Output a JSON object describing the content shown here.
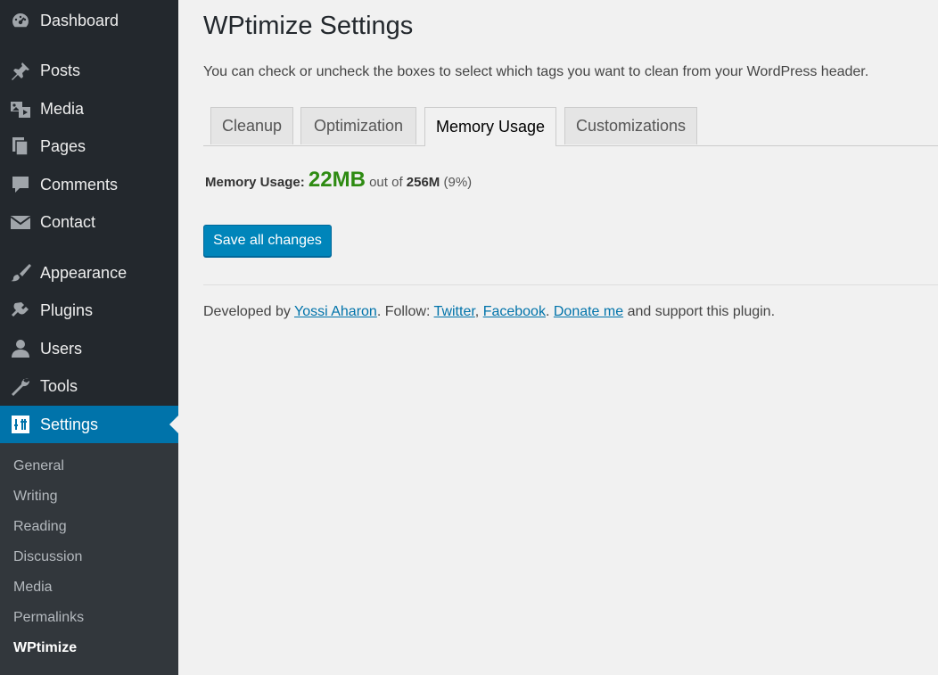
{
  "sidebar": {
    "items": [
      {
        "label": "Dashboard",
        "icon": "dashboard-icon"
      },
      {
        "label": "Posts",
        "icon": "pushpin-icon"
      },
      {
        "label": "Media",
        "icon": "media-icon"
      },
      {
        "label": "Pages",
        "icon": "pages-icon"
      },
      {
        "label": "Comments",
        "icon": "comment-bubble-icon"
      },
      {
        "label": "Contact",
        "icon": "envelope-icon"
      },
      {
        "label": "Appearance",
        "icon": "paintbrush-icon"
      },
      {
        "label": "Plugins",
        "icon": "plug-icon"
      },
      {
        "label": "Users",
        "icon": "user-icon"
      },
      {
        "label": "Tools",
        "icon": "wrench-icon"
      },
      {
        "label": "Settings",
        "icon": "settings-sliders-icon",
        "current": true
      }
    ],
    "submenu": [
      {
        "label": "General"
      },
      {
        "label": "Writing"
      },
      {
        "label": "Reading"
      },
      {
        "label": "Discussion"
      },
      {
        "label": "Media"
      },
      {
        "label": "Permalinks"
      },
      {
        "label": "WPtimize",
        "current": true
      }
    ]
  },
  "main": {
    "title": "WPtimize Settings",
    "intro": "You can check or uncheck the boxes to select which tags you want to clean from your WordPress header.",
    "tabs": [
      {
        "label": "Cleanup"
      },
      {
        "label": "Optimization"
      },
      {
        "label": "Memory Usage",
        "active": true
      },
      {
        "label": "Customizations"
      }
    ],
    "memory": {
      "label": "Memory Usage:",
      "used": "22MB",
      "out_of": "out of",
      "total": "256M",
      "percent": "(9%)"
    },
    "save_label": "Save all changes",
    "footer": {
      "developed_by": "Developed by",
      "author_link": "Yossi Aharon",
      "follow": ". Follow:",
      "twitter_link": "Twitter",
      "comma": ",",
      "facebook_link": "Facebook",
      "period": ".",
      "donate_link": "Donate me",
      "tail": "and support this plugin."
    }
  },
  "colors": {
    "sidebar_bg": "#23282d",
    "submenu_bg": "#32373c",
    "accent": "#0073aa",
    "button": "#0085ba",
    "memory_value": "#2e8b12"
  }
}
